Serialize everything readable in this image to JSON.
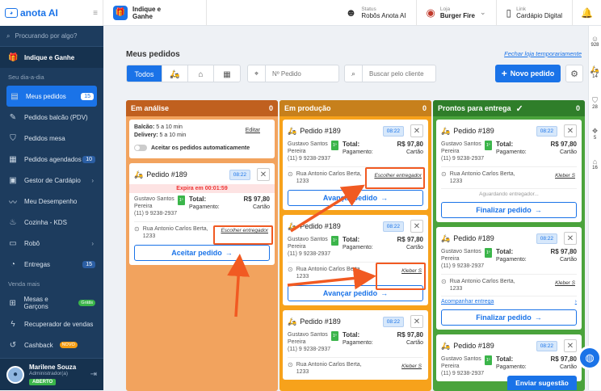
{
  "app": {
    "logo_text": "anota AI"
  },
  "sidebar": {
    "search_placeholder": "Procurando por algo?",
    "indique": "Indique e Ganhe",
    "section_day": "Seu dia-a-dia",
    "items": [
      {
        "label": "Meus pedidos",
        "badge": "15"
      },
      {
        "label": "Pedidos balcão (PDV)"
      },
      {
        "label": "Pedidos mesa"
      },
      {
        "label": "Pedidos agendados",
        "badge": "10"
      },
      {
        "label": "Gestor de Cardápio"
      },
      {
        "label": "Meu Desempenho"
      },
      {
        "label": "Cozinha - KDS"
      },
      {
        "label": "Robô"
      },
      {
        "label": "Entregas",
        "badge": "15"
      }
    ],
    "section_sell": "Venda mais",
    "sell_items": [
      {
        "label": "Mesas e Garçons",
        "tag": "Grátis"
      },
      {
        "label": "Recuperador de vendas"
      },
      {
        "label": "Cashback",
        "tag": "NOVO"
      }
    ],
    "user": {
      "name": "Marilene Souza",
      "role": "Administrador(a)",
      "status": "ABERTO"
    }
  },
  "topbar": {
    "indique": "Indique e Ganhe",
    "status_label": "Status",
    "status_value": "Robôs Anota AI",
    "store_label": "Loja",
    "store_value": "Burger Fire",
    "link_label": "Link",
    "link_value": "Cardápio Digital"
  },
  "main": {
    "title": "Meus pedidos",
    "close_link": "Fechar loja temporariamente",
    "filter_all": "Todos",
    "order_placeholder": "Nº Pedido",
    "search_placeholder": "Buscar pelo cliente",
    "new_order": "Novo pedido"
  },
  "columns": {
    "analysis": {
      "title": "Em análise",
      "count": "0"
    },
    "production": {
      "title": "Em produção",
      "count": "0"
    },
    "ready": {
      "title": "Prontos para entrega",
      "count": "0"
    }
  },
  "config": {
    "balcao_label": "Balcão:",
    "balcao_value": "5 a 10 min",
    "delivery_label": "Delivery:",
    "delivery_value": "5 a 10 min",
    "edit": "Editar",
    "auto_accept": "Aceitar os pedidos automaticamente"
  },
  "order": {
    "number": "Pedido #189",
    "time": "08:22",
    "expires": "Expira em 00:01:59",
    "customer_line1": "Gustavo Santos",
    "customer_line2": "Pereira",
    "phone": "(11) 9 9238-2937",
    "vip": "1º",
    "total_label": "Total:",
    "total_value": "R$ 97,80",
    "payment_label": "Pagamento:",
    "payment_value": "Cartão",
    "address_line1": "Rua Antonio Carlos Berta,",
    "address_line2": "1233",
    "choose_courier": "Escolher entregador",
    "courier": "Kleber S",
    "accept": "Aceitar pedido",
    "advance": "Avançar pedido",
    "finish": "Finalizar pedido",
    "waiting": "Aguardando entregador...",
    "track": "Acompanhar entrega"
  },
  "rightstrip": [
    "928",
    "14",
    "28",
    "5",
    "16"
  ],
  "suggestion": "Enviar sugestão",
  "colors": {
    "primary": "#1a73e8",
    "sidebar": "#1d3c5e",
    "analysis": "#c0601f",
    "production": "#c7801c",
    "ready": "#2f7e2a",
    "highlight": "#f15a22"
  }
}
